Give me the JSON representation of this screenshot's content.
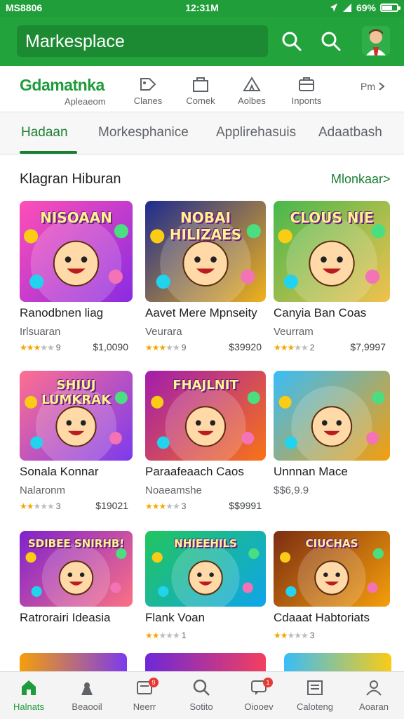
{
  "status_bar": {
    "carrier": "MS8806",
    "time": "12:31M",
    "battery": "69%",
    "battery_level": 0.69
  },
  "header": {
    "search_text": "Markesplace"
  },
  "category_strip": {
    "brand_title": "Gdamatnka",
    "brand_subtitle": "Apleaeom",
    "items": [
      {
        "label": "Clanes",
        "icon": "tag-icon"
      },
      {
        "label": "Comek",
        "icon": "bag-icon"
      },
      {
        "label": "Aolbes",
        "icon": "tent-icon"
      },
      {
        "label": "Inponts",
        "icon": "briefcase-icon"
      }
    ],
    "more_label": "Pm"
  },
  "tabs": [
    {
      "label": "Hadaan",
      "active": true
    },
    {
      "label": "Morkesphanice",
      "active": false
    },
    {
      "label": "Applirehasuis",
      "active": false
    },
    {
      "label": "Adaatbash",
      "active": false
    }
  ],
  "section": {
    "title": "Klagran Hiburan",
    "more_label": "Mlonkaar>"
  },
  "apps": [
    {
      "title": "Ranodbnen liag",
      "developer": "Irlsuaran",
      "rating": 3,
      "rating_count": "9",
      "price": "$1,0090",
      "thumb_text": "NISOAAN",
      "colors": [
        "#ff4fb6",
        "#8a2be2"
      ]
    },
    {
      "title": "Aavet Mere Mpnseity",
      "developer": "Veurara",
      "rating": 3,
      "rating_count": "9",
      "price": "$39920",
      "thumb_text": "NOBAI HILIZAES",
      "colors": [
        "#1d2b8f",
        "#f0b21b"
      ]
    },
    {
      "title": "Canyia Ban Coas",
      "developer": "Veurram",
      "rating": 3,
      "rating_count": "2",
      "price": "$7,9997",
      "thumb_text": "CLOUS NIE",
      "colors": [
        "#46b84c",
        "#f2c14e"
      ]
    },
    {
      "title": "Sonala Konnar",
      "developer": "Nalaronm",
      "rating": 2,
      "rating_count": "3",
      "price": "$19021",
      "thumb_text": "SHIUJ LUMKRAK",
      "colors": [
        "#ff6f91",
        "#7c3aed"
      ]
    },
    {
      "title": "Paraafeaach Caos",
      "developer": "Noaeamshe",
      "rating": 3,
      "rating_count": "3",
      "price": "$$9991",
      "thumb_text": "FHAJLNIT",
      "colors": [
        "#a21caf",
        "#f97316"
      ]
    },
    {
      "title": "Unnnan Mace",
      "developer": "$$6,9.9",
      "rating": 0,
      "rating_count": "",
      "price": "",
      "thumb_text": "",
      "colors": [
        "#38bdf8",
        "#f59e0b"
      ]
    },
    {
      "title": "Ratrorairi Ideasia",
      "developer": "",
      "rating": 0,
      "rating_count": "",
      "price": "",
      "thumb_text": "SDIBEE SNIRHB!",
      "colors": [
        "#7e22ce",
        "#fb7185"
      ]
    },
    {
      "title": "Flank Voan",
      "developer": "",
      "rating": 2,
      "rating_count": "1",
      "price": "",
      "thumb_text": "NHIEEHILS",
      "colors": [
        "#22c55e",
        "#0ea5e9"
      ]
    },
    {
      "title": "Cdaaat Habtoriats",
      "developer": "",
      "rating": 2,
      "rating_count": "3",
      "price": "",
      "thumb_text": "CIUCHAS",
      "colors": [
        "#7c2d12",
        "#f59e0b"
      ]
    }
  ],
  "bottom_nav": [
    {
      "label": "Halnats",
      "icon": "home-icon",
      "active": true,
      "badge": ""
    },
    {
      "label": "Beaooil",
      "icon": "person-icon",
      "active": false,
      "badge": ""
    },
    {
      "label": "Neerr",
      "icon": "inbox-icon",
      "active": false,
      "badge": "9"
    },
    {
      "label": "Sotito",
      "icon": "search-icon",
      "active": false,
      "badge": ""
    },
    {
      "label": "Oiooev",
      "icon": "chat-icon",
      "active": false,
      "badge": "1"
    },
    {
      "label": "Caloteng",
      "icon": "calendar-icon",
      "active": false,
      "badge": ""
    },
    {
      "label": "Aoaran",
      "icon": "profile-icon",
      "active": false,
      "badge": ""
    }
  ]
}
